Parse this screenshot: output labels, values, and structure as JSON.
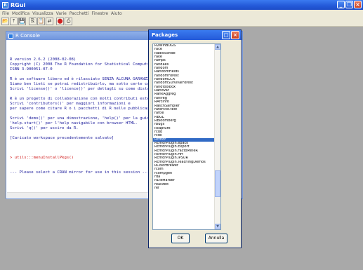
{
  "app": {
    "title": "RGui"
  },
  "menu": [
    "File",
    "Modifica",
    "Visualizza",
    "Varie",
    "Pacchetti",
    "Finestre",
    "Aiuto"
  ],
  "console": {
    "title": "R Console",
    "lines": [
      "",
      "R version 2.6.2 (2008-02-08)",
      "Copyright (C) 2008 The R Foundation for Statistical Computing",
      "ISBN 3-900051-07-0",
      "",
      "R è un software libero ed è rilasciato SENZA ALCUNA GARANZIA.",
      "Siamo ben lieti se potrai redistribuirlo, ma sotto certe condizioni.",
      "Scrivi 'license()' o 'licence()' per dettagli su come distribuirlo.",
      "",
      "R è un progetto di collaborazione con molti contributi esterni.",
      "Scrivi 'contributors()' per maggiori informazioni e",
      "per sapere come citare R o i pacchetti di R nelle pubblicazioni.",
      "",
      "Scrivi 'demo()' per una dimostrazione, 'help()' per la guida in linea, o",
      "'help.start()' per l'help navigabile con browser HTML.",
      "Scrivi 'q()' per uscire da R.",
      "",
      "[Caricato workspace precedentemente salvato]",
      ""
    ],
    "command": "> utils:::menuInstallPkgs()",
    "message": "--- Please select a CRAN mirror for use in this session ---"
  },
  "dialog": {
    "title": "Packages",
    "items": [
      "R2WinBUGS",
      "race",
      "RadioSonde",
      "rake",
      "ramps",
      "randaes",
      "random",
      "RandomFields",
      "randomForest",
      "randomLCA",
      "randomSurvivalForest",
      "randtoolbox",
      "RandVar",
      "RankAggreg",
      "ranlreg",
      "RArcInfo",
      "RaschSampler",
      "raters4o.test",
      "rattle",
      "RBGL",
      "RBloomberg",
      "rbugs",
      "Rcapture",
      "rcdd",
      "rcdk",
      "Rcmdr",
      "RcmdrPlugin.epack",
      "RcmdrPlugin.Export",
      "RcmdrPlugin.FactoMineR",
      "RcmdrPlugin.HH",
      "RcmdrPlugin.IPSUR",
      "RcmdrPlugin.TeachingDemos",
      "RColorBrewer",
      "rcom",
      "rcompgen",
      "rda",
      "RDieHarder",
      "realized",
      "ref"
    ],
    "selected_index": 25,
    "ok_label": "OK",
    "cancel_label": "Annulla"
  }
}
